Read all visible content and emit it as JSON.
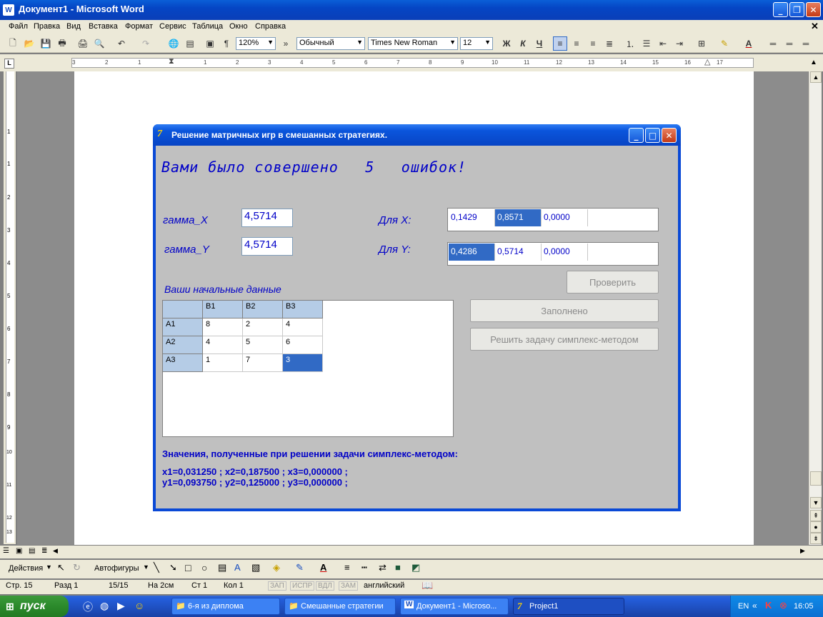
{
  "word": {
    "title": "Документ1 - Microsoft Word",
    "menu": [
      "Файл",
      "Правка",
      "Вид",
      "Вставка",
      "Формат",
      "Сервис",
      "Таблица",
      "Окно",
      "Справка"
    ],
    "toolbar": {
      "zoom": "120%",
      "style": "Обычный",
      "font": "Times New Roman",
      "size": "12",
      "bold": "Ж",
      "italic": "К",
      "underline": "Ч"
    },
    "ruler": {
      "h_marks": [
        "3",
        "2",
        "1",
        "1",
        "2",
        "3",
        "4",
        "5",
        "6",
        "7",
        "8",
        "9",
        "10",
        "11",
        "12",
        "13",
        "14",
        "15",
        "16",
        "17"
      ],
      "v_marks": [
        "1",
        "1",
        "2",
        "3",
        "4",
        "5",
        "6",
        "7",
        "8",
        "9",
        "10",
        "11",
        "12",
        "13"
      ]
    },
    "drawbar": {
      "actions": "Действия",
      "autoshapes": "Автофигуры"
    },
    "status": {
      "page": "Стр. 15",
      "section": "Разд 1",
      "pages": "15/15",
      "at": "На 2см",
      "line": "Ст 1",
      "col": "Кол 1",
      "rec": "ЗАП",
      "trk": "ИСПР",
      "ext": "ВДЛ",
      "ovr": "ЗАМ",
      "lang": "английский"
    }
  },
  "app": {
    "title": "Решение матричных игр в смешанных стратегиях.",
    "errors_prefix": "Вами было совершено",
    "errors_count": "5",
    "errors_suffix": "ошибок!",
    "gamma_x_label": "гамма_X",
    "gamma_x_value": "4,5714",
    "gamma_y_label": "гамма_Y",
    "gamma_y_value": "4,5714",
    "for_x_label": "Для X:",
    "for_x_values": [
      "0,1429",
      "0,8571",
      "0,0000"
    ],
    "for_y_label": "Для Y:",
    "for_y_values": [
      "0,4286",
      "0,5714",
      "0,0000"
    ],
    "check_button": "Проверить",
    "filled_button": "Заполнено",
    "simplex_button": "Решить задачу симплекс-методом",
    "initial_data_label": "Ваши начальные данные",
    "grid": {
      "columns": [
        "B1",
        "B2",
        "B3"
      ],
      "rows": [
        {
          "name": "A1",
          "values": [
            "8",
            "2",
            "4"
          ]
        },
        {
          "name": "A2",
          "values": [
            "4",
            "5",
            "6"
          ]
        },
        {
          "name": "A3",
          "values": [
            "1",
            "7",
            "3"
          ]
        }
      ]
    },
    "simplex_label": "Значения, полученные при решении задачи симплекс-методом:",
    "simplex_x": "x1=0,031250 ; x2=0,187500 ; x3=0,000000 ;",
    "simplex_y": "y1=0,093750 ; y2=0,125000 ; y3=0,000000 ;"
  },
  "taskbar": {
    "start": "пуск",
    "tasks": [
      "6-я из диплома",
      "Смешанные стратегии",
      "Документ1 - Microso...",
      "Project1"
    ],
    "lang": "EN",
    "clock": "16:05"
  }
}
